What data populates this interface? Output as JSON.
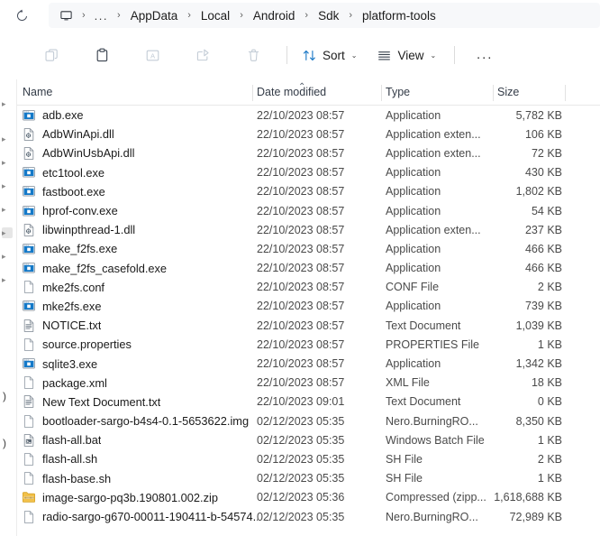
{
  "window": {
    "title": "platform-tools"
  },
  "addressbar": {
    "refresh_icon": "refresh-icon",
    "pc_icon": "monitor-icon",
    "overflow": "...",
    "separator": "›",
    "crumbs": [
      {
        "label": "AppData"
      },
      {
        "label": "Local"
      },
      {
        "label": "Android"
      },
      {
        "label": "Sdk"
      },
      {
        "label": "platform-tools"
      }
    ]
  },
  "toolbar": {
    "buttons": [
      {
        "name": "copy-button",
        "icon": "copy-icon",
        "label": "",
        "disabled": true
      },
      {
        "name": "paste-button",
        "icon": "paste-icon",
        "label": "",
        "disabled": false
      },
      {
        "name": "rename-button",
        "icon": "rename-icon",
        "label": "",
        "disabled": true
      },
      {
        "name": "share-button",
        "icon": "share-icon",
        "label": "",
        "disabled": true
      },
      {
        "name": "delete-button",
        "icon": "trash-icon",
        "label": "",
        "disabled": true
      }
    ],
    "sort_label": "Sort",
    "view_label": "View",
    "overflow_label": "...",
    "chevron": "⌄"
  },
  "columns": {
    "name": "Name",
    "date_modified": "Date modified",
    "type": "Type",
    "size": "Size",
    "sort_caret": "⌃",
    "sorted_by": "Date modified",
    "sort_direction": "ascending"
  },
  "files": [
    {
      "name": "adb.exe",
      "date": "22/10/2023 08:57",
      "type": "Application",
      "size": "5,782 KB",
      "icon": "application-icon"
    },
    {
      "name": "AdbWinApi.dll",
      "date": "22/10/2023 08:57",
      "type": "Application exten...",
      "size": "106 KB",
      "icon": "dll-icon"
    },
    {
      "name": "AdbWinUsbApi.dll",
      "date": "22/10/2023 08:57",
      "type": "Application exten...",
      "size": "72 KB",
      "icon": "dll-icon"
    },
    {
      "name": "etc1tool.exe",
      "date": "22/10/2023 08:57",
      "type": "Application",
      "size": "430 KB",
      "icon": "application-icon"
    },
    {
      "name": "fastboot.exe",
      "date": "22/10/2023 08:57",
      "type": "Application",
      "size": "1,802 KB",
      "icon": "application-icon"
    },
    {
      "name": "hprof-conv.exe",
      "date": "22/10/2023 08:57",
      "type": "Application",
      "size": "54 KB",
      "icon": "application-icon"
    },
    {
      "name": "libwinpthread-1.dll",
      "date": "22/10/2023 08:57",
      "type": "Application exten...",
      "size": "237 KB",
      "icon": "dll-icon"
    },
    {
      "name": "make_f2fs.exe",
      "date": "22/10/2023 08:57",
      "type": "Application",
      "size": "466 KB",
      "icon": "application-icon"
    },
    {
      "name": "make_f2fs_casefold.exe",
      "date": "22/10/2023 08:57",
      "type": "Application",
      "size": "466 KB",
      "icon": "application-icon"
    },
    {
      "name": "mke2fs.conf",
      "date": "22/10/2023 08:57",
      "type": "CONF File",
      "size": "2 KB",
      "icon": "blank-file-icon"
    },
    {
      "name": "mke2fs.exe",
      "date": "22/10/2023 08:57",
      "type": "Application",
      "size": "739 KB",
      "icon": "application-icon"
    },
    {
      "name": "NOTICE.txt",
      "date": "22/10/2023 08:57",
      "type": "Text Document",
      "size": "1,039 KB",
      "icon": "text-file-icon"
    },
    {
      "name": "source.properties",
      "date": "22/10/2023 08:57",
      "type": "PROPERTIES File",
      "size": "1 KB",
      "icon": "blank-file-icon"
    },
    {
      "name": "sqlite3.exe",
      "date": "22/10/2023 08:57",
      "type": "Application",
      "size": "1,342 KB",
      "icon": "application-icon"
    },
    {
      "name": "package.xml",
      "date": "22/10/2023 08:57",
      "type": "XML File",
      "size": "18 KB",
      "icon": "blank-file-icon"
    },
    {
      "name": "New Text Document.txt",
      "date": "22/10/2023 09:01",
      "type": "Text Document",
      "size": "0 KB",
      "icon": "text-file-icon"
    },
    {
      "name": "bootloader-sargo-b4s4-0.1-5653622.img",
      "date": "02/12/2023 05:35",
      "type": "Nero.BurningRO...",
      "size": "8,350 KB",
      "icon": "blank-file-icon"
    },
    {
      "name": "flash-all.bat",
      "date": "02/12/2023 05:35",
      "type": "Windows Batch File",
      "size": "1 KB",
      "icon": "bat-file-icon"
    },
    {
      "name": "flash-all.sh",
      "date": "02/12/2023 05:35",
      "type": "SH File",
      "size": "2 KB",
      "icon": "blank-file-icon"
    },
    {
      "name": "flash-base.sh",
      "date": "02/12/2023 05:35",
      "type": "SH File",
      "size": "1 KB",
      "icon": "blank-file-icon"
    },
    {
      "name": "image-sargo-pq3b.190801.002.zip",
      "date": "02/12/2023 05:36",
      "type": "Compressed (zipp...",
      "size": "1,618,688 KB",
      "icon": "zip-folder-icon"
    },
    {
      "name": "radio-sargo-g670-00011-190411-b-54574...",
      "date": "02/12/2023 05:35",
      "type": "Nero.BurningRO...",
      "size": "72,989 KB",
      "icon": "blank-file-icon"
    }
  ],
  "colors": {
    "accent": "#0078d4",
    "app_icon_blue": "#1479c8",
    "zip_yellow": "#f2c14a",
    "text": "#1a1a1a",
    "secondary_text": "#4a4a4a",
    "header_text": "#333b47",
    "address_bg": "#f7f8fa",
    "divider": "#e8e8e8"
  }
}
